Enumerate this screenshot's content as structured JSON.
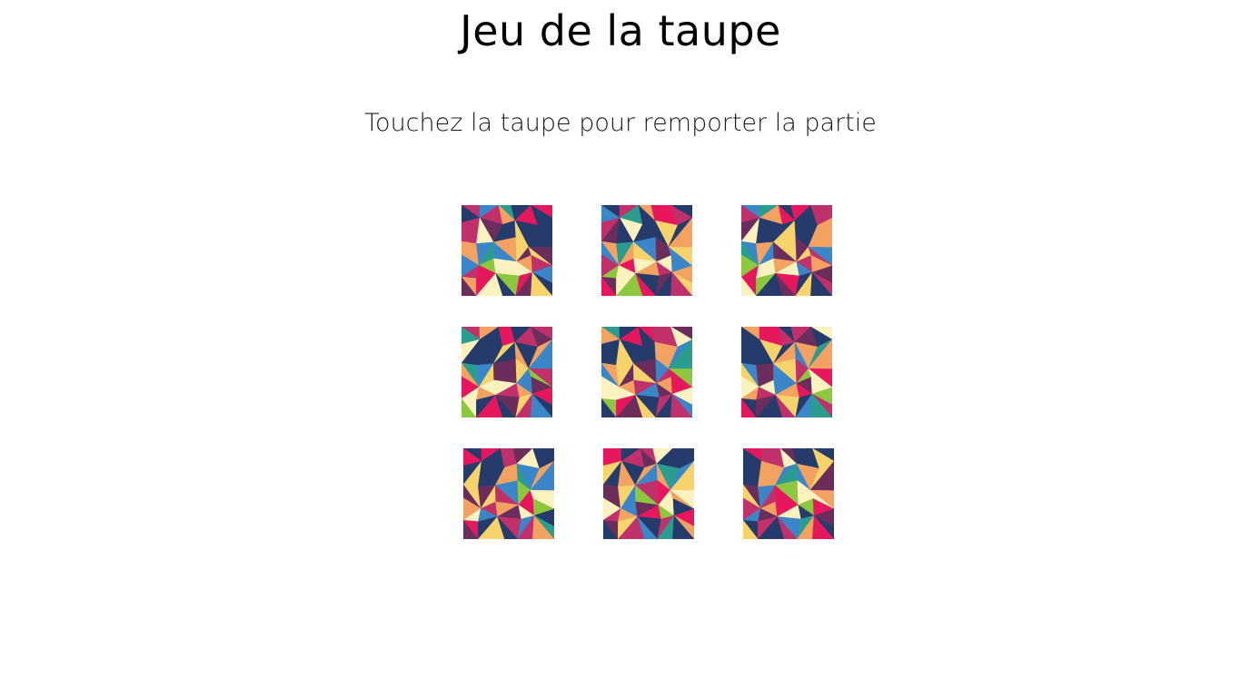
{
  "title": "Jeu de la taupe",
  "subtitle": "Touchez la taupe pour remporter la partie",
  "board": {
    "rows": 3,
    "columns": 3,
    "tile_image": "low-poly-geometric-pattern",
    "tile_palette": [
      "#e6175c",
      "#2a9d8f",
      "#f4a261",
      "#fbf2c0",
      "#243b6b",
      "#8dc63f",
      "#c0306b",
      "#3a86c8",
      "#f6d36b",
      "#6b2d5c"
    ],
    "holes": [
      {
        "name": "hole-1"
      },
      {
        "name": "hole-2"
      },
      {
        "name": "hole-3"
      },
      {
        "name": "hole-4"
      },
      {
        "name": "hole-5"
      },
      {
        "name": "hole-6"
      },
      {
        "name": "hole-7"
      },
      {
        "name": "hole-8"
      },
      {
        "name": "hole-9"
      }
    ]
  }
}
